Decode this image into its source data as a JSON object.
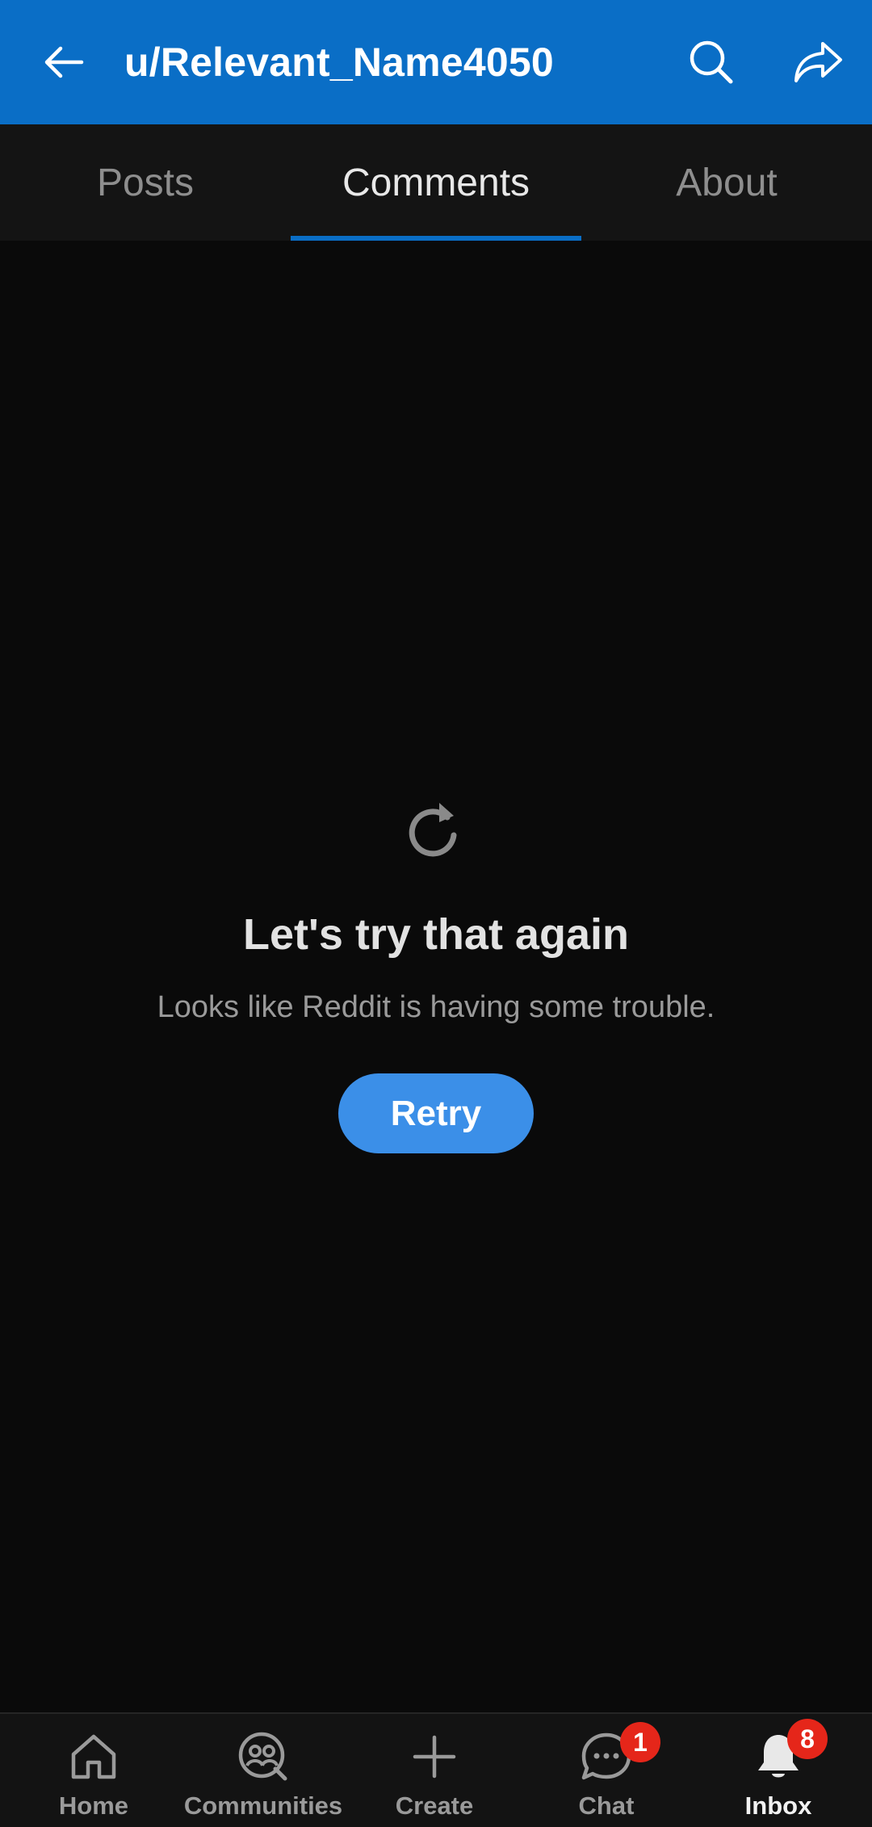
{
  "header": {
    "title": "u/Relevant_Name4050",
    "background": "#0a6ec6"
  },
  "tabs": [
    {
      "label": "Posts",
      "active": false
    },
    {
      "label": "Comments",
      "active": true
    },
    {
      "label": "About",
      "active": false
    }
  ],
  "error": {
    "icon": "refresh-icon",
    "title": "Let's try that again",
    "subtitle": "Looks like Reddit is having some trouble.",
    "retry_label": "Retry",
    "retry_color": "#3b8fe8"
  },
  "bottom_nav": {
    "items": [
      {
        "label": "Home",
        "icon": "home-icon",
        "active": false
      },
      {
        "label": "Communities",
        "icon": "communities-icon",
        "active": false
      },
      {
        "label": "Create",
        "icon": "plus-icon",
        "active": false
      },
      {
        "label": "Chat",
        "icon": "chat-icon",
        "active": false,
        "badge": "1"
      },
      {
        "label": "Inbox",
        "icon": "bell-icon",
        "active": true,
        "badge": "8"
      }
    ],
    "badge_color": "#e5261a"
  }
}
